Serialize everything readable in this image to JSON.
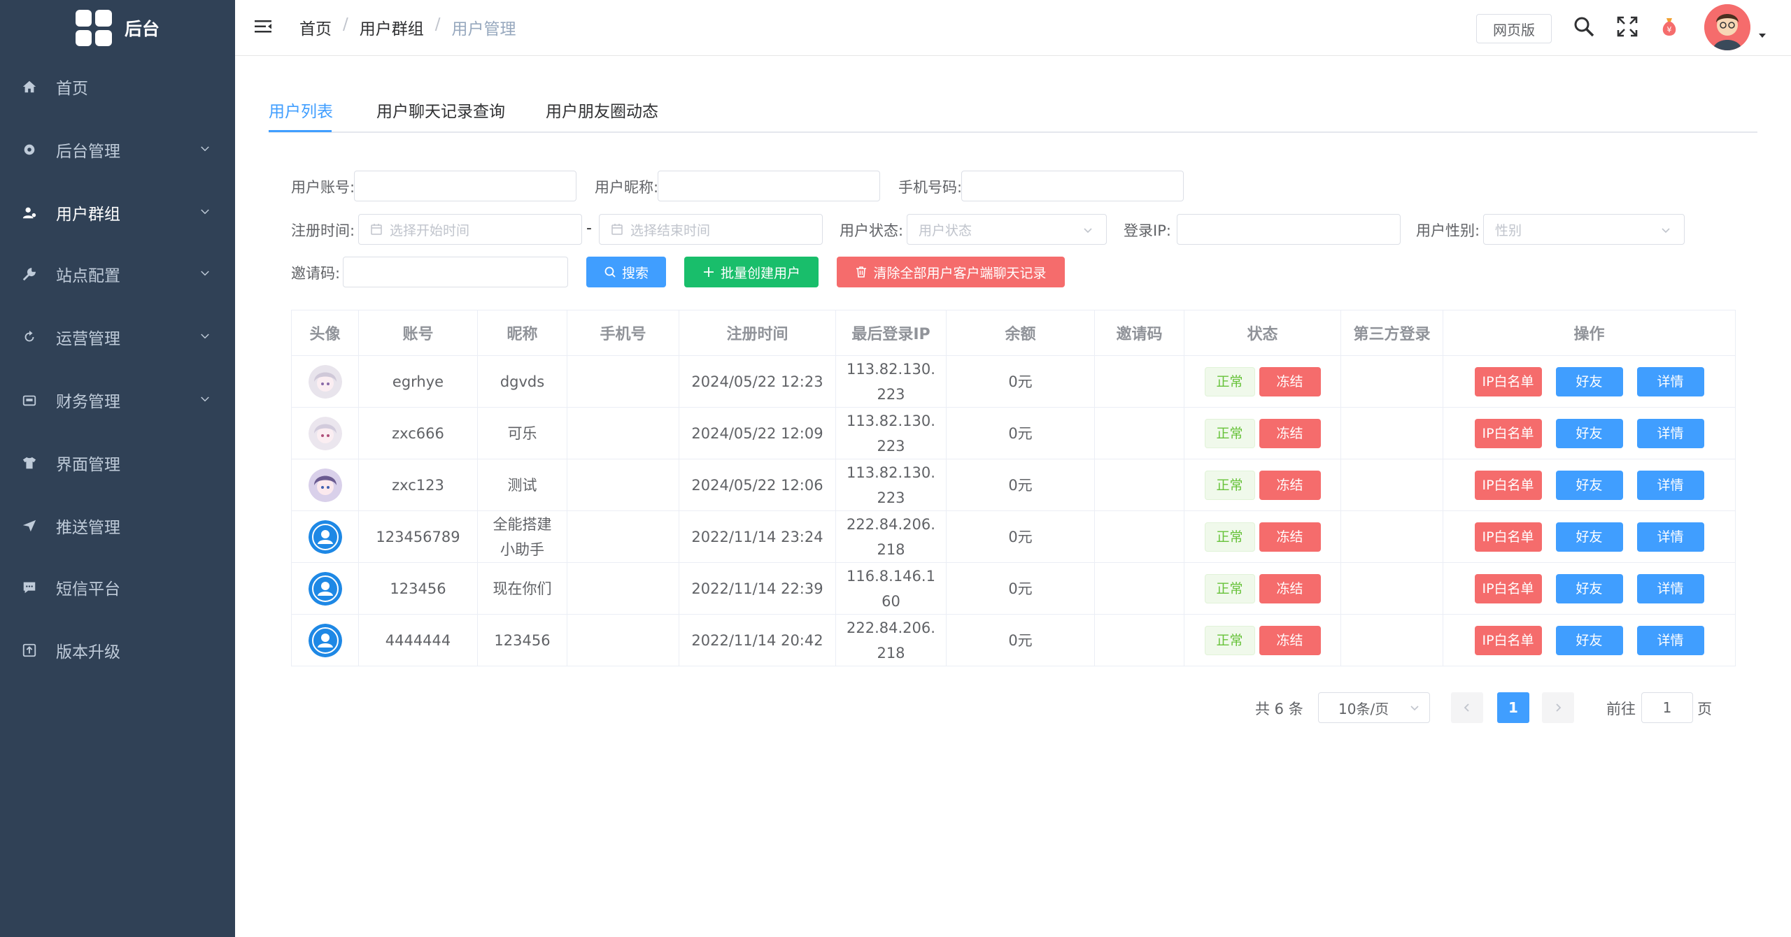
{
  "app": {
    "title": "后台"
  },
  "sidebar": {
    "items": [
      {
        "label": "首页",
        "icon": "home-icon"
      },
      {
        "label": "后台管理",
        "icon": "gear-icon"
      },
      {
        "label": "用户群组",
        "icon": "users-icon"
      },
      {
        "label": "站点配置",
        "icon": "wrench-icon"
      },
      {
        "label": "运营管理",
        "icon": "refresh-icon"
      },
      {
        "label": "财务管理",
        "icon": "wallet-icon"
      },
      {
        "label": "界面管理",
        "icon": "shirt-icon"
      },
      {
        "label": "推送管理",
        "icon": "send-icon"
      },
      {
        "label": "短信平台",
        "icon": "chat-icon"
      },
      {
        "label": "版本升级",
        "icon": "upgrade-icon"
      }
    ]
  },
  "header": {
    "breadcrumb": [
      "首页",
      "用户群组",
      "用户管理"
    ],
    "web_version_label": "网页版"
  },
  "tabs": [
    "用户列表",
    "用户聊天记录查询",
    "用户朋友圈动态"
  ],
  "filters": {
    "account_label": "用户账号:",
    "nickname_label": "用户昵称:",
    "phone_label": "手机号码:",
    "reg_time_label": "注册时间:",
    "start_placeholder": "选择开始时间",
    "end_placeholder": "选择结束时间",
    "date_separator": "-",
    "status_label": "用户状态:",
    "status_placeholder": "用户状态",
    "ip_label": "登录IP:",
    "gender_label": "用户性别:",
    "gender_placeholder": "性别",
    "invite_label": "邀请码:"
  },
  "actions": {
    "search": "搜索",
    "batch_create": "批量创建用户",
    "clear_chat": "清除全部用户客户端聊天记录"
  },
  "colors": {
    "sidebar_bg": "#304156",
    "primary": "#409eff",
    "success": "#19be6b",
    "danger": "#f56c6c"
  },
  "table": {
    "headers": [
      "头像",
      "账号",
      "昵称",
      "手机号",
      "注册时间",
      "最后登录IP",
      "余额",
      "邀请码",
      "状态",
      "第三方登录",
      "操作"
    ],
    "status_ok": "正常",
    "status_freeze": "冻结",
    "op_whitelist": "IP白名单",
    "op_friends": "好友",
    "op_detail": "详情",
    "rows": [
      {
        "avatar": "anime-avatar",
        "account": "egrhye",
        "nickname": "dgvds",
        "phone": "",
        "reg_time": "2024/05/22 12:23",
        "ip1": "113.82.130.",
        "ip2": "223",
        "balance": "0元",
        "invite": ""
      },
      {
        "avatar": "anime-avatar",
        "account": "zxc666",
        "nickname": "可乐",
        "phone": "",
        "reg_time": "2024/05/22 12:09",
        "ip1": "113.82.130.",
        "ip2": "223",
        "balance": "0元",
        "invite": ""
      },
      {
        "avatar": "anime-avatar",
        "account": "zxc123",
        "nickname": "测试",
        "phone": "",
        "reg_time": "2024/05/22 12:06",
        "ip1": "113.82.130.",
        "ip2": "223",
        "balance": "0元",
        "invite": ""
      },
      {
        "avatar": "default-avatar",
        "account": "123456789",
        "nickname1": "全能搭建",
        "nickname2": "小助手",
        "phone": "",
        "reg_time": "2022/11/14 23:24",
        "ip1": "222.84.206.",
        "ip2": "218",
        "balance": "0元",
        "invite": ""
      },
      {
        "avatar": "default-avatar",
        "account": "123456",
        "nickname": "现在你们",
        "phone": "",
        "reg_time": "2022/11/14 22:39",
        "ip1": "116.8.146.1",
        "ip2": "60",
        "balance": "0元",
        "invite": ""
      },
      {
        "avatar": "default-avatar",
        "account": "4444444",
        "nickname": "123456",
        "phone": "",
        "reg_time": "2022/11/14 20:42",
        "ip1": "222.84.206.",
        "ip2": "218",
        "balance": "0元",
        "invite": ""
      }
    ]
  },
  "pagination": {
    "total": "共 6 条",
    "page_size": "10条/页",
    "current_page": "1",
    "goto_label": "前往",
    "goto_value": "1",
    "page_unit": "页"
  }
}
